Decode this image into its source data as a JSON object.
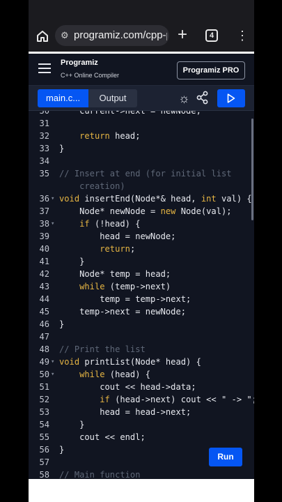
{
  "browser": {
    "url": "programiz.com/cpp-p",
    "tab_count": "4",
    "icons": [
      "home-icon",
      "tune-icon",
      "plus-icon",
      "more-vert-icon"
    ]
  },
  "header": {
    "logo_name": "Programiz",
    "logo_subtitle": "C++ Online Compiler",
    "pro_button": "Programiz PRO"
  },
  "toolbar": {
    "tab_main": "main.c...",
    "tab_output": "Output",
    "icons": [
      "sun-icon",
      "share-icon",
      "play-icon"
    ],
    "accent": "#0556f3"
  },
  "editor": {
    "lines": [
      {
        "n": "30",
        "fold": "",
        "text": "    current->next = newNode;"
      },
      {
        "n": "31",
        "fold": "",
        "text": ""
      },
      {
        "n": "32",
        "fold": "",
        "text": "    return head;"
      },
      {
        "n": "33",
        "fold": "",
        "text": "}"
      },
      {
        "n": "34",
        "fold": "",
        "text": ""
      },
      {
        "n": "35",
        "fold": "",
        "text": "// Insert at end (for initial list"
      },
      {
        "n": "",
        "fold": "",
        "text": "    creation)"
      },
      {
        "n": "36",
        "fold": "▾",
        "text": "void insertEnd(Node*& head, int val) {"
      },
      {
        "n": "37",
        "fold": "",
        "text": "    Node* newNode = new Node(val);"
      },
      {
        "n": "38",
        "fold": "▾",
        "text": "    if (!head) {"
      },
      {
        "n": "39",
        "fold": "",
        "text": "        head = newNode;"
      },
      {
        "n": "40",
        "fold": "",
        "text": "        return;"
      },
      {
        "n": "41",
        "fold": "",
        "text": "    }"
      },
      {
        "n": "42",
        "fold": "",
        "text": "    Node* temp = head;"
      },
      {
        "n": "43",
        "fold": "",
        "text": "    while (temp->next)"
      },
      {
        "n": "44",
        "fold": "",
        "text": "        temp = temp->next;"
      },
      {
        "n": "45",
        "fold": "",
        "text": "    temp->next = newNode;"
      },
      {
        "n": "46",
        "fold": "",
        "text": "}"
      },
      {
        "n": "47",
        "fold": "",
        "text": ""
      },
      {
        "n": "48",
        "fold": "",
        "text": "// Print the list"
      },
      {
        "n": "49",
        "fold": "▾",
        "text": "void printList(Node* head) {"
      },
      {
        "n": "50",
        "fold": "▾",
        "text": "    while (head) {"
      },
      {
        "n": "51",
        "fold": "",
        "text": "        cout << head->data;"
      },
      {
        "n": "52",
        "fold": "",
        "text": "        if (head->next) cout << \" -> \";"
      },
      {
        "n": "53",
        "fold": "",
        "text": "        head = head->next;"
      },
      {
        "n": "54",
        "fold": "",
        "text": "    }"
      },
      {
        "n": "55",
        "fold": "",
        "text": "    cout << endl;"
      },
      {
        "n": "56",
        "fold": "",
        "text": "}"
      },
      {
        "n": "57",
        "fold": "",
        "text": ""
      },
      {
        "n": "58",
        "fold": "",
        "text": "// Main function"
      }
    ]
  },
  "run_button": "Run"
}
